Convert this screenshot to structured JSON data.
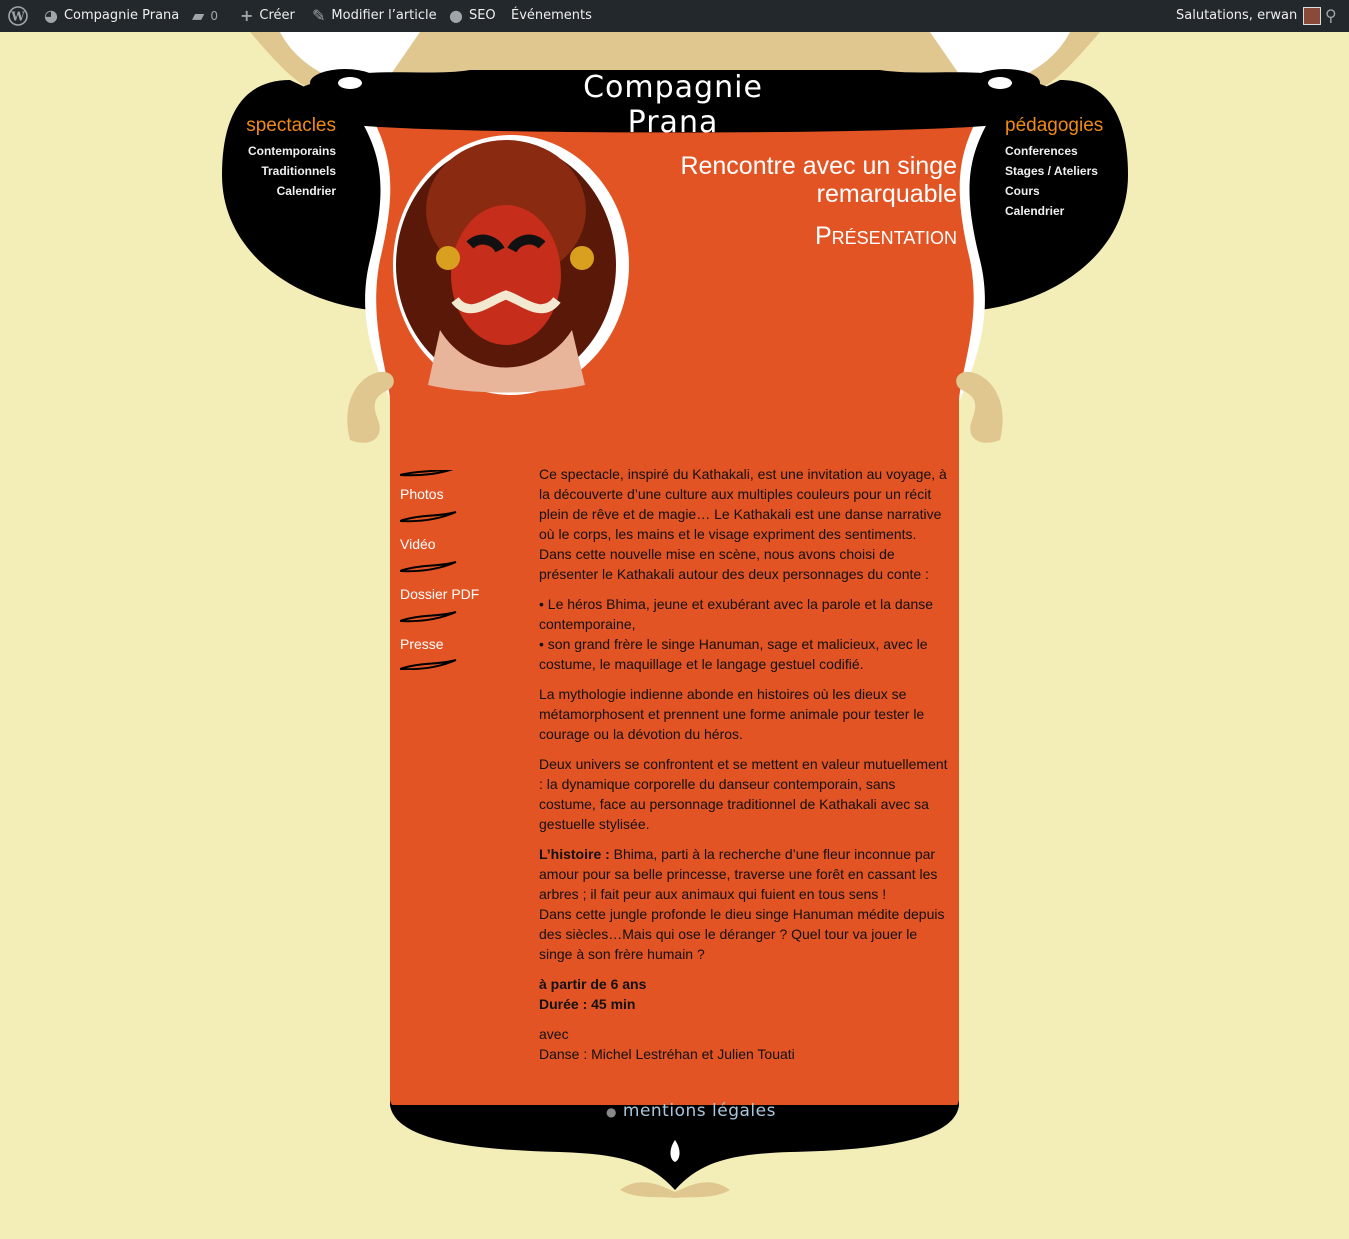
{
  "adminbar": {
    "site_name": "Compagnie Prana",
    "comments_count": "0",
    "create_label": "Créer",
    "edit_label": "Modifier l’article",
    "seo_label": "SEO",
    "events_label": "Événements",
    "greeting": "Salutations, erwan"
  },
  "logo": "Compagnie Prana",
  "nav_left": {
    "heading": "spectacles",
    "items": [
      "Contemporains",
      "Traditionnels",
      "Calendrier"
    ]
  },
  "nav_right": {
    "heading": "pédagogies",
    "items": [
      "Conferences",
      "Stages / Ateliers",
      "Cours",
      "Calendrier"
    ]
  },
  "show_title": "Rencontre avec un singe remarquable",
  "section_title": "Présentation",
  "sub_menu": [
    "Photos",
    "Vidéo",
    "Dossier PDF",
    "Presse"
  ],
  "content": {
    "p1": "Ce spectacle, inspiré du Kathakali, est une invitation au voyage, à la découverte d’une culture aux multiples couleurs pour un récit plein de rêve et de magie… Le Kathakali est une danse narrative où le corps, les mains et le visage expriment des sentiments. Dans cette nouvelle mise en scène, nous avons choisi de présenter le Kathakali autour des deux personnages du conte :",
    "p2a": "• Le héros Bhima, jeune et exubérant avec la parole et la danse contemporaine,",
    "p2b": "• son grand frère le singe Hanuman, sage et malicieux, avec le costume, le maquillage et le langage gestuel codifié.",
    "p3": "La mythologie indienne abonde en histoires où les dieux se métamorphosent et prennent une forme animale pour tester le courage ou la dévotion du héros.",
    "p4": "Deux univers se confrontent et se mettent en valeur mutuellement : la dynamique corporelle du danseur contemporain, sans costume, face au personnage traditionnel de Kathakali avec sa gestuelle stylisée.",
    "story_label": "L’histoire :",
    "p5a": " Bhima, parti à la recherche d’une fleur inconnue par amour pour sa belle princesse, traverse une forêt en cassant les arbres ; il fait peur aux animaux qui fuient en tous sens !",
    "p5b": "Dans cette jungle profonde le dieu singe Hanuman médite depuis des siècles…Mais qui ose le déranger ? Quel tour va jouer le singe à son frère humain ?",
    "age": "à partir de 6 ans",
    "duration": "Durée : 45 min",
    "with": "avec",
    "cast": "Danse : Michel Lestréhan et Julien Touati"
  },
  "legal_link": "mentions légales",
  "colors": {
    "page_bg": "#f3edb7",
    "panel": "#e35425",
    "accent": "#f08a17",
    "deco_tan": "#dfc78f"
  }
}
